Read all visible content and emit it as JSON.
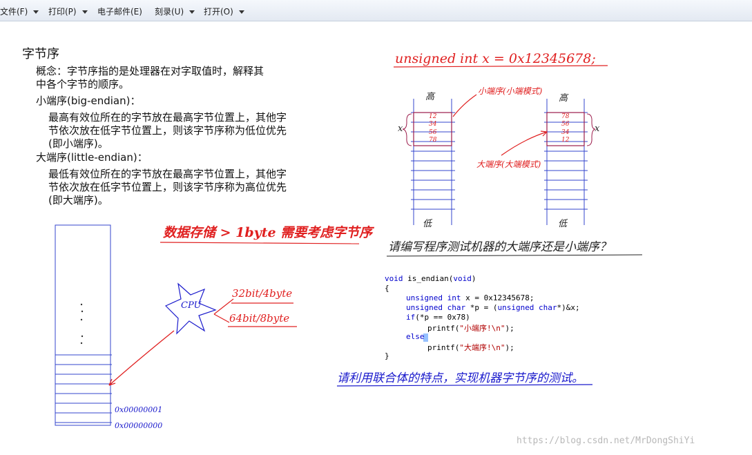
{
  "menu": [
    {
      "label": "文件(F)",
      "dropdown": true
    },
    {
      "label": "打印(P)",
      "dropdown": true
    },
    {
      "label": "电子邮件(E)",
      "dropdown": false
    },
    {
      "label": "刻录(U)",
      "dropdown": true
    },
    {
      "label": "打开(O)",
      "dropdown": true
    }
  ],
  "slide": {
    "title": "字节序",
    "concept_l1": "概念：字节序指的是处理器在对字取值时，解释其",
    "concept_l2": "中各个字节的顺序。",
    "small_heading": "小端序(big-endian)：",
    "small_l1": "最高有效位所在的字节放在最高字节位置上，其他字",
    "small_l2": "节依次放在低字节位置上，则该字节序称为低位优先",
    "small_l3": "(即小端序)。",
    "big_heading": "大端序(little-endian)：",
    "big_l1": "最低有效位所在的字节放在最高字节位置上，其他字",
    "big_l2": "节依次放在低字节位置上，则该字节序称为高位优先",
    "big_l3": "(即大端序)。"
  },
  "annotations": {
    "top_decl": "unsigned int x = 0x12345678;",
    "label_small_mode": "小端序(小端模式)",
    "label_big_mode": "大端序(大端模式)",
    "high_left": "高",
    "high_right": "高",
    "low_left": "低",
    "low_right": "低",
    "x_left": "x",
    "x_right": "x",
    "left_cells": [
      "12",
      "34",
      "56",
      "78"
    ],
    "right_cells": [
      "78",
      "56",
      "34",
      "12"
    ],
    "data_storage": "数据存储 > 1byte 需要考虑字节序",
    "cpu": "CPU",
    "bit32": "32bit/4byte",
    "bit64": "64bit/8byte",
    "addr1": "0x00000001",
    "addr0": "0x00000000",
    "question": "请编写程序测试机器的大端序还是小端序？",
    "union_note": "请利用联合体的特点，实现机器字节序的测试。"
  },
  "code": {
    "l1_a": "void",
    "l1_b": " is_endian(",
    "l1_c": "void",
    "l1_d": ")",
    "l2": "{",
    "l3_kw": "unsigned int",
    "l3_rest": " x = 0x12345678;",
    "l4_kw1": "unsigned char",
    "l4_mid": " *p = (",
    "l4_kw2": "unsigned char",
    "l4_rest": "*)&x;",
    "l5_kw": "if",
    "l5_rest": "(*p == 0x78)",
    "l6_a": "printf(",
    "l6_str": "\"小端序!\\n\"",
    "l6_b": ");",
    "l7_kw": "else",
    "l8_a": "printf(",
    "l8_str": "\"大端序!\\n\"",
    "l8_b": ");",
    "l9": "}"
  },
  "watermark": "https://blog.csdn.net/MrDongShiYi",
  "colors": {
    "ink_red": "#e02020",
    "ink_blue": "#1a1acc",
    "diagram_blue": "#3344cc",
    "keyword": "#0000cc"
  }
}
